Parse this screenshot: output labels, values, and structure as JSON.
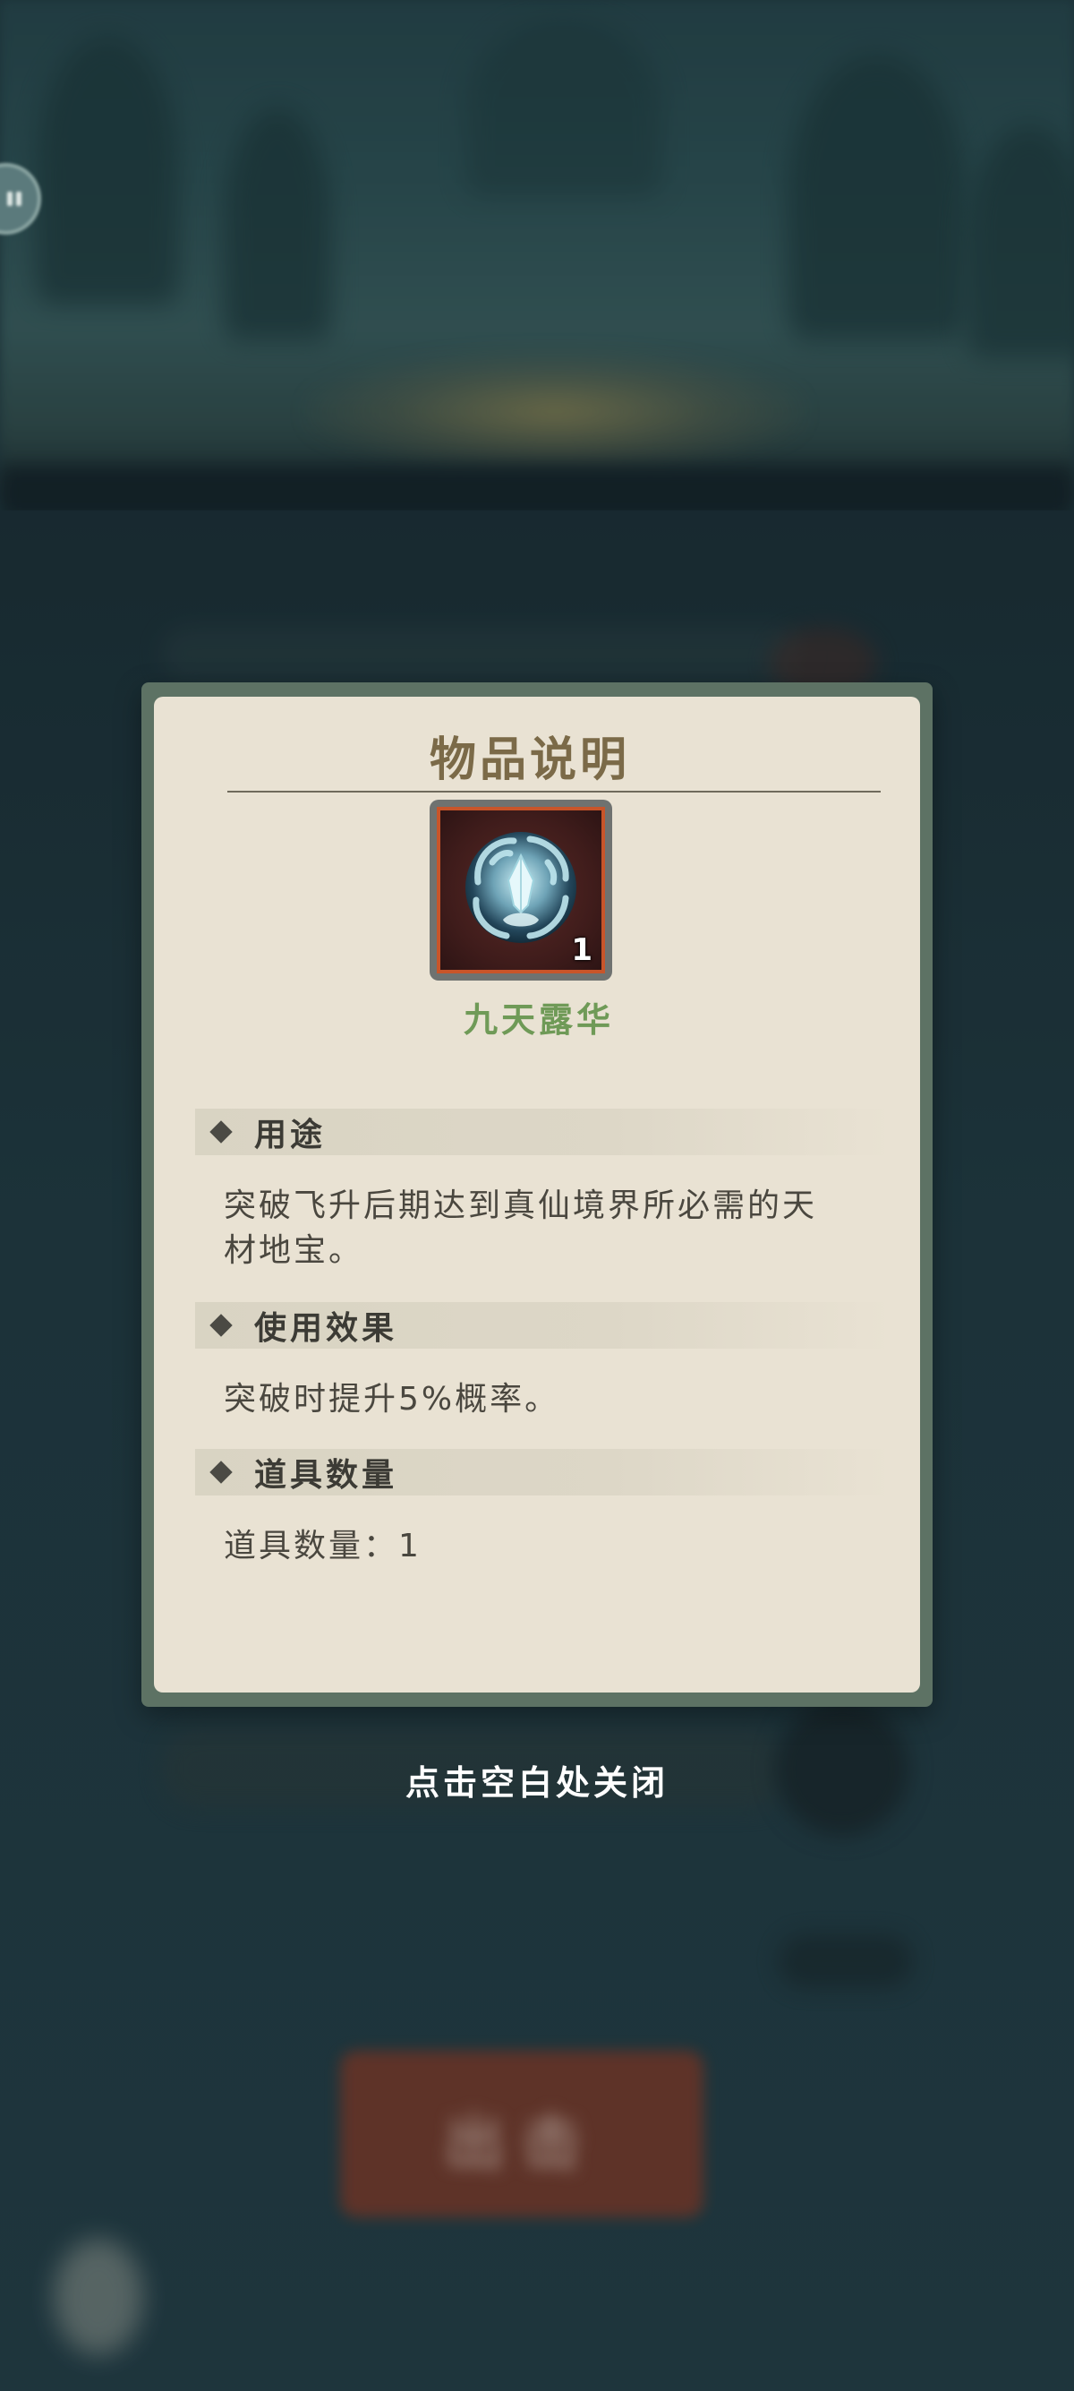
{
  "background": {
    "blurred_button_text": "出击"
  },
  "dialog": {
    "title": "物品说明",
    "item": {
      "name": "九天露华",
      "count": "1",
      "icon": "dew-crystal-orb-icon"
    },
    "sections": [
      {
        "header": "用途",
        "text": "突破飞升后期达到真仙境界所必需的天材地宝。"
      },
      {
        "header": "使用效果",
        "text": "突破时提升5%概率。"
      },
      {
        "header": "道具数量",
        "text": "道具数量：1"
      }
    ]
  },
  "close_hint": "点击空白处关闭",
  "colors": {
    "panel": "#e9e2d3",
    "frame": "#5d7264",
    "title": "#7b6a48",
    "item_name": "#6f9a57",
    "slot_border": "#c8552a"
  }
}
